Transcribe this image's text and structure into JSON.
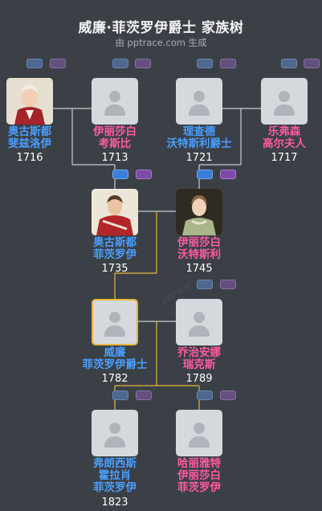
{
  "header": {
    "title": "威廉·菲茨罗伊爵士 家族树",
    "subtitle": "由 pptrace.com 生成"
  },
  "people": {
    "p1": {
      "name1": "奥古斯都",
      "name2": "斐兹洛伊",
      "year": "1716"
    },
    "p2": {
      "name1": "伊丽莎白",
      "name2": "考斯比",
      "year": "1713"
    },
    "p3": {
      "name1": "理查德",
      "name2": "沃特斯利爵士",
      "year": "1721"
    },
    "p4": {
      "name1": "乐弗森",
      "name2": "高尔夫人",
      "year": "1717"
    },
    "p5": {
      "name1": "奥古斯都",
      "name2": "菲茨罗伊",
      "year": "1735"
    },
    "p6": {
      "name1": "伊丽莎白",
      "name2": "沃特斯利",
      "year": "1745"
    },
    "p7": {
      "name1": "威廉",
      "name2": "菲茨罗伊爵士",
      "year": "1782"
    },
    "p8": {
      "name1": "乔治安娜",
      "name2": "瑞克斯",
      "year": "1789"
    },
    "p9": {
      "name1": "弗朗西斯",
      "name2": "霍拉肖",
      "name3": "菲茨罗伊",
      "year": "1823"
    },
    "p10": {
      "name1": "哈丽雅特",
      "name2": "伊丽莎白",
      "name3": "菲茨罗伊"
    }
  },
  "colors": {
    "male": "#4a9eff",
    "female": "#ff5aa3",
    "focus_line": "#e8b63a",
    "line": "#c9ccd0"
  }
}
